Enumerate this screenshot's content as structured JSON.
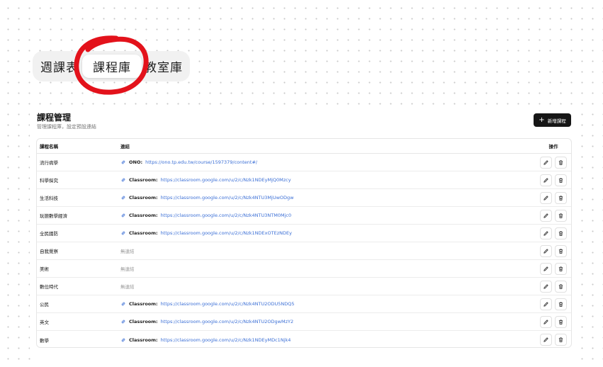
{
  "tabs": [
    {
      "label": "週課表"
    },
    {
      "label": "課程庫"
    },
    {
      "label": "教室庫"
    }
  ],
  "card": {
    "title": "課程管理",
    "subtitle": "管理課程庫，設定預設連結",
    "add_button_label": "新增課程"
  },
  "table": {
    "headers": {
      "name": "課程名稱",
      "link": "連結",
      "actions": "操作"
    },
    "rows": [
      {
        "name": "流行病學",
        "label": "ONO:",
        "url": "https://ono.tp.edu.tw/course/1597379/content#/"
      },
      {
        "name": "科學探究",
        "label": "Classroom:",
        "url": "https://classroom.google.com/u/2/c/Nzk1NDEyMjQ0Mzcy"
      },
      {
        "name": "生活科技",
        "label": "Classroom:",
        "url": "https://classroom.google.com/u/2/c/Nzk4NTU3MjUwODgw"
      },
      {
        "name": "玩戀數學經濟",
        "label": "Classroom:",
        "url": "https://classroom.google.com/u/2/c/Nzk4NTU3NTM0Mjc0"
      },
      {
        "name": "全民國防",
        "label": "Classroom:",
        "url": "https://classroom.google.com/u/2/c/Nzk1NDExOTEzNDEy"
      },
      {
        "name": "自我覺察",
        "label": "",
        "url": "",
        "empty": "無連結"
      },
      {
        "name": "美術",
        "label": "",
        "url": "",
        "empty": "無連結"
      },
      {
        "name": "數位時代",
        "label": "",
        "url": "",
        "empty": "無連結"
      },
      {
        "name": "公民",
        "label": "Classroom:",
        "url": "https://classroom.google.com/u/2/c/Nzk4NTU2ODU5NDQ5"
      },
      {
        "name": "英文",
        "label": "Classroom:",
        "url": "https://classroom.google.com/u/2/c/Nzk4NTU2ODgwMzY2"
      },
      {
        "name": "數學",
        "label": "Classroom:",
        "url": "https://classroom.google.com/u/2/c/Nzk1NDEyMDc1Njk4"
      }
    ]
  },
  "icons": {
    "link": "link-icon",
    "edit": "pencil-icon",
    "delete": "trash-icon",
    "add": "plus-icon"
  },
  "colors": {
    "accent": "#3b6fd6",
    "button_bg": "#161616",
    "annotation": "#e3121b"
  }
}
